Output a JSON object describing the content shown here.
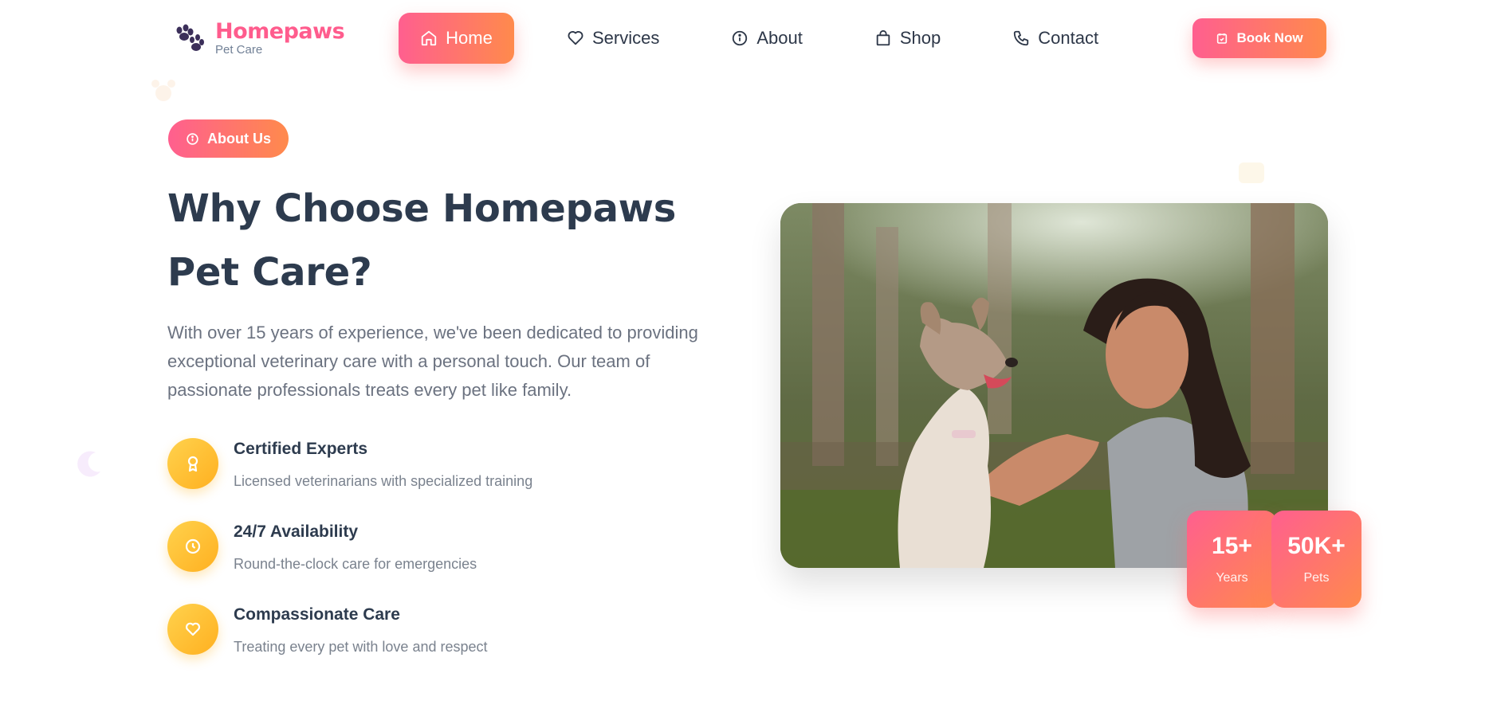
{
  "brand": {
    "name": "Homepaws",
    "tagline": "Pet Care",
    "color": "#ff5c8d"
  },
  "nav": {
    "items": [
      {
        "label": "Home",
        "icon": "home-icon",
        "active": true
      },
      {
        "label": "Services",
        "icon": "heart-icon"
      },
      {
        "label": "About",
        "icon": "info-icon"
      },
      {
        "label": "Shop",
        "icon": "bag-icon"
      },
      {
        "label": "Contact",
        "icon": "phone-icon"
      }
    ],
    "cta": "Book Now"
  },
  "section": {
    "badge": "About Us",
    "title": "Why Choose Homepaws Pet Care?",
    "description": "With over 15 years of experience, we've been dedicated to providing exceptional veterinary care with a personal touch. Our team of passionate professionals treats every pet like family."
  },
  "features": [
    {
      "title": "Certified Experts",
      "desc": "Licensed veterinarians with specialized training",
      "icon": "award-icon"
    },
    {
      "title": "24/7 Availability",
      "desc": "Round-the-clock care for emergencies",
      "icon": "clock-icon"
    },
    {
      "title": "Compassionate Care",
      "desc": "Treating every pet with love and respect",
      "icon": "heart-icon"
    }
  ],
  "stats": [
    {
      "value": "15+",
      "label": "Years"
    },
    {
      "value": "50K+",
      "label": "Pets"
    }
  ],
  "colors": {
    "accent_start": "#ff5f8f",
    "accent_end": "#ff8a4c",
    "feature_icon": "#ffc233",
    "heading": "#2d3b4e"
  }
}
